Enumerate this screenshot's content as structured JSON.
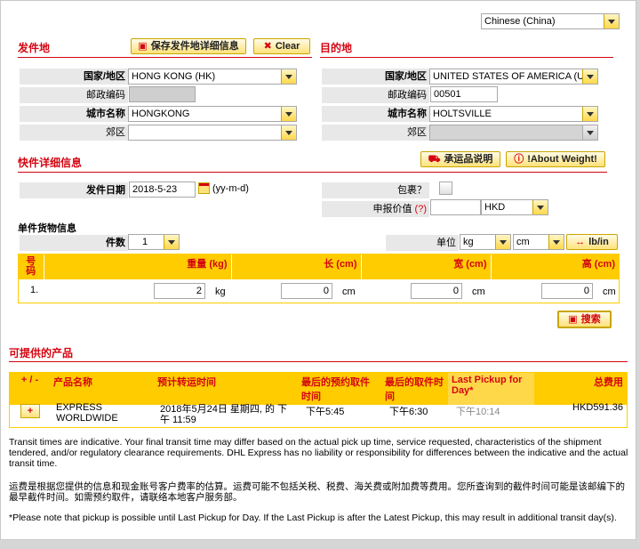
{
  "language": {
    "value": "Chinese (China)"
  },
  "origin": {
    "title": "发件地",
    "save_label": "保存发件地详细信息",
    "clear_label": "Clear",
    "country_label": "国家/地区",
    "country_value": "HONG KONG (HK)",
    "postal_label": "邮政编码",
    "postal_value": "",
    "city_label": "城市名称",
    "city_value": "HONGKONG",
    "suburb_label": "郊区",
    "suburb_value": ""
  },
  "destination": {
    "title": "目的地",
    "country_label": "国家/地区",
    "country_value": "UNITED STATES OF AMERICA (US)",
    "postal_label": "邮政编码",
    "postal_value": "00501",
    "city_label": "城市名称",
    "city_value": "HOLTSVILLE",
    "suburb_label": "郊区",
    "suburb_value": ""
  },
  "shipment": {
    "title": "快件详细信息",
    "carrier_terms_label": "承运品说明",
    "about_weight_label": "!About Weight!",
    "date_label": "发件日期",
    "date_value": "2018-5-23",
    "date_format": "(yy-m-d)",
    "package_label": "包裹？",
    "declared_label": "申报价值",
    "declared_help": "(?)",
    "declared_value": "",
    "currency_value": "HKD"
  },
  "pieces": {
    "title": "单件货物信息",
    "count_label": "件数",
    "count_value": "1",
    "unit_label": "单位",
    "weight_unit": "kg",
    "length_unit": "cm",
    "toggle_label": "lb/in",
    "headers": {
      "no": "号码",
      "weight": "重量 (kg)",
      "length": "长 (cm)",
      "width": "宽 (cm)",
      "height": "高 (cm)"
    },
    "row": {
      "no": "1.",
      "weight": "2",
      "weight_unit": "kg",
      "length": "0",
      "length_unit": "cm",
      "width": "0",
      "width_unit": "cm",
      "height": "0",
      "height_unit": "cm"
    },
    "search_label": "搜索"
  },
  "results": {
    "title": "可提供的产品",
    "headers": {
      "toggle": "+ / -",
      "product": "产品名称",
      "transit": "预计转运时间",
      "last_booking": "最后的预约取件时间",
      "last_pickup": "最后的取件时间",
      "last_pickup_day": "Last Pickup for Day*",
      "total": "总费用"
    },
    "row": {
      "toggle": "+",
      "product": "EXPRESS WORLDWIDE",
      "transit": "2018年5月24日 星期四, 的 下午 11:59",
      "last_booking": "下午5:45",
      "last_pickup": "下午6:30",
      "last_pickup_day": "下午10:14",
      "total": "HKD591.36"
    }
  },
  "notes": {
    "en": "Transit times are indicative. Your final transit time may differ based on the actual pick up time, service requested, characteristics of the shipment tendered, and/or regulatory clearance requirements. DHL Express has no liability or responsibility for differences between the indicative and the actual transit time.",
    "zh": "运费是根据您提供的信息和现金账号客户费率的估算。运费可能不包括关税、税费、海关费或附加费等费用。您所查询到的截件时间可能是该邮编下的最早截件时间。如需预约取件，请联络本地客户服务部。",
    "pickup": "*Please note that pickup is possible until Last Pickup for Day. If the Last Pickup is after the Latest Pickup, this may result in additional transit day(s)."
  },
  "colors": {
    "brand_red": "#d40511",
    "brand_yellow": "#ffcc00"
  }
}
